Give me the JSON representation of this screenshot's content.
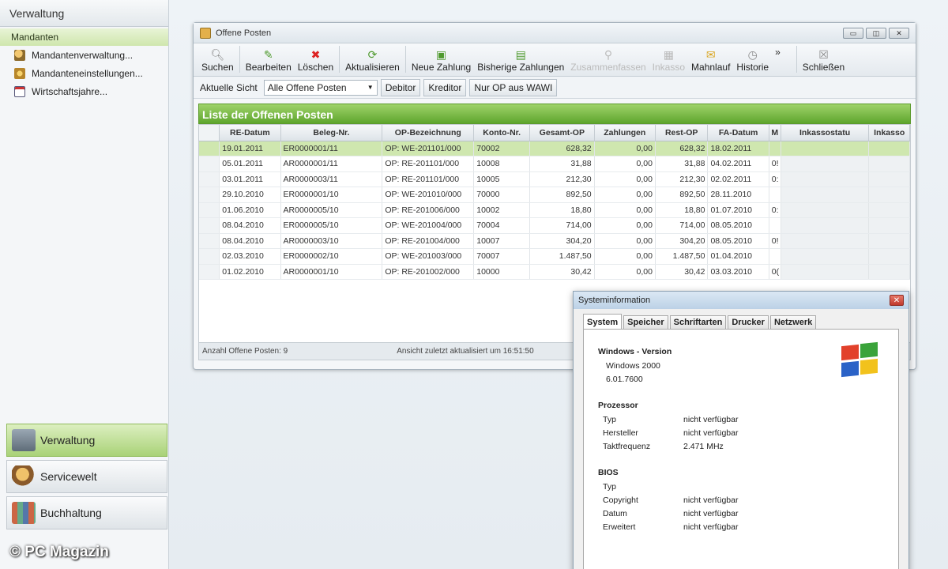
{
  "sidebar": {
    "header": "Verwaltung",
    "section": "Mandanten",
    "items": [
      {
        "label": "Mandantenverwaltung...",
        "icon": "users-icon"
      },
      {
        "label": "Mandanteneinstellungen...",
        "icon": "settings-icon"
      },
      {
        "label": "Wirtschaftsjahre...",
        "icon": "calendar-icon"
      }
    ],
    "nav": [
      {
        "label": "Verwaltung",
        "active": true
      },
      {
        "label": "Servicewelt",
        "active": false
      },
      {
        "label": "Buchhaltung",
        "active": false
      }
    ]
  },
  "watermark": "© PC Magazin",
  "window": {
    "title": "Offene Posten",
    "controls": [
      "minimize",
      "maximize",
      "close"
    ]
  },
  "toolbar": {
    "suchen": "Suchen",
    "bearbeiten": "Bearbeiten",
    "loeschen": "Löschen",
    "aktualisieren": "Aktualisieren",
    "neue_zahlung": "Neue Zahlung",
    "bisherige_zahlungen": "Bisherige Zahlungen",
    "zusammenfassen": "Zusammenfassen",
    "inkasso": "Inkasso",
    "mahnlauf": "Mahnlauf",
    "historie": "Historie",
    "more": "»",
    "schliessen": "Schließen"
  },
  "viewbar": {
    "label": "Aktuelle Sicht",
    "selected": "Alle Offene Posten",
    "filters": [
      "Debitor",
      "Kreditor",
      "Nur OP aus WAWI"
    ]
  },
  "list": {
    "title": "Liste der Offenen Posten",
    "columns": [
      "RE-Datum",
      "Beleg-Nr.",
      "OP-Bezeichnung",
      "Konto-Nr.",
      "Gesamt-OP",
      "Zahlungen",
      "Rest-OP",
      "FA-Datum",
      "M",
      "Inkassostatu",
      "Inkasso"
    ],
    "rows": [
      {
        "re_datum": "19.01.2011",
        "beleg": "ER0000001/11",
        "op": "OP: WE-201101/000",
        "konto": "70002",
        "gesamt": "628,32",
        "zahlungen": "0,00",
        "rest": "628,32",
        "fa_datum": "18.02.2011",
        "m": ""
      },
      {
        "re_datum": "05.01.2011",
        "beleg": "AR0000001/11",
        "op": "OP: RE-201101/000",
        "konto": "10008",
        "gesamt": "31,88",
        "zahlungen": "0,00",
        "rest": "31,88",
        "fa_datum": "04.02.2011",
        "m": "0!"
      },
      {
        "re_datum": "03.01.2011",
        "beleg": "AR0000003/11",
        "op": "OP: RE-201101/000",
        "konto": "10005",
        "gesamt": "212,30",
        "zahlungen": "0,00",
        "rest": "212,30",
        "fa_datum": "02.02.2011",
        "m": "0:"
      },
      {
        "re_datum": "29.10.2010",
        "beleg": "ER0000001/10",
        "op": "OP: WE-201010/000",
        "konto": "70000",
        "gesamt": "892,50",
        "zahlungen": "0,00",
        "rest": "892,50",
        "fa_datum": "28.11.2010",
        "m": ""
      },
      {
        "re_datum": "01.06.2010",
        "beleg": "AR0000005/10",
        "op": "OP: RE-201006/000",
        "konto": "10002",
        "gesamt": "18,80",
        "zahlungen": "0,00",
        "rest": "18,80",
        "fa_datum": "01.07.2010",
        "m": "0:"
      },
      {
        "re_datum": "08.04.2010",
        "beleg": "ER0000005/10",
        "op": "OP: WE-201004/000",
        "konto": "70004",
        "gesamt": "714,00",
        "zahlungen": "0,00",
        "rest": "714,00",
        "fa_datum": "08.05.2010",
        "m": ""
      },
      {
        "re_datum": "08.04.2010",
        "beleg": "AR0000003/10",
        "op": "OP: RE-201004/000",
        "konto": "10007",
        "gesamt": "304,20",
        "zahlungen": "0,00",
        "rest": "304,20",
        "fa_datum": "08.05.2010",
        "m": "0!"
      },
      {
        "re_datum": "02.03.2010",
        "beleg": "ER0000002/10",
        "op": "OP: WE-201003/000",
        "konto": "70007",
        "gesamt": "1.487,50",
        "zahlungen": "0,00",
        "rest": "1.487,50",
        "fa_datum": "01.04.2010",
        "m": ""
      },
      {
        "re_datum": "01.02.2010",
        "beleg": "AR0000001/10",
        "op": "OP: RE-201002/000",
        "konto": "10000",
        "gesamt": "30,42",
        "zahlungen": "0,00",
        "rest": "30,42",
        "fa_datum": "03.03.2010",
        "m": "0("
      }
    ]
  },
  "status": {
    "count": "Anzahl Offene Posten: 9",
    "updated": "Ansicht zuletzt aktualisiert um 16:51:50"
  },
  "sysinfo": {
    "title": "Systeminformation",
    "tabs": [
      "System",
      "Speicher",
      "Schriftarten",
      "Drucker",
      "Netzwerk"
    ],
    "windows_title": "Windows - Version",
    "windows_name": "Windows 2000",
    "windows_version": "6.01.7600",
    "processor_title": "Prozessor",
    "processor": [
      {
        "k": "Typ",
        "v": "nicht verfügbar"
      },
      {
        "k": "Hersteller",
        "v": "nicht verfügbar"
      },
      {
        "k": "Taktfrequenz",
        "v": "2.471 MHz"
      }
    ],
    "bios_title": "BIOS",
    "bios": [
      {
        "k": "Typ",
        "v": ""
      },
      {
        "k": "Copyright",
        "v": "nicht verfügbar"
      },
      {
        "k": "Datum",
        "v": "nicht verfügbar"
      },
      {
        "k": "Erweitert",
        "v": "nicht verfügbar"
      }
    ]
  }
}
